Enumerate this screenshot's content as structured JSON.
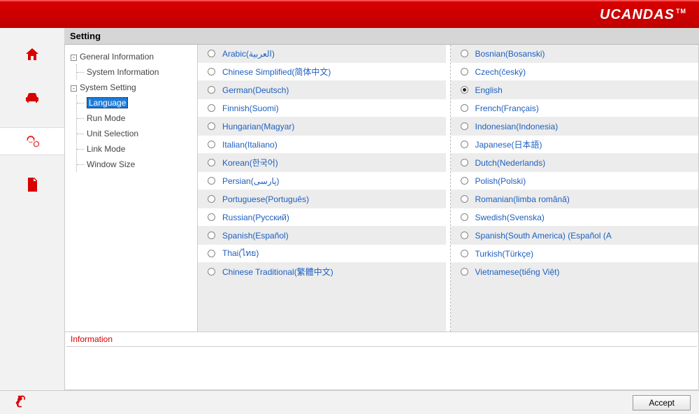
{
  "brand": {
    "name": "UCANDAS",
    "tm": "TM"
  },
  "title": "Setting",
  "tree": {
    "group1": {
      "label": "General Information",
      "children": [
        {
          "label": "System Information"
        }
      ]
    },
    "group2": {
      "label": "System Setting",
      "children": [
        {
          "label": "Language",
          "selected": true
        },
        {
          "label": "Run Mode"
        },
        {
          "label": "Unit Selection"
        },
        {
          "label": "Link Mode"
        },
        {
          "label": "Window Size"
        }
      ]
    }
  },
  "languages": {
    "left": [
      "Arabic(العربية)",
      "Chinese Simplified(简体中文)",
      "German(Deutsch)",
      "Finnish(Suomi)",
      "Hungarian(Magyar)",
      "Italian(Italiano)",
      "Korean(한국어)",
      "Persian(پارسى)",
      "Portuguese(Português)",
      "Russian(Русский)",
      "Spanish(Español)",
      "Thai(ไทย)",
      "Chinese Traditional(繁體中文)"
    ],
    "right": [
      "Bosnian(Bosanski)",
      "Czech(český)",
      "English",
      "French(Français)",
      "Indonesian(Indonesia)",
      "Japanese(日本語)",
      "Dutch(Nederlands)",
      "Polish(Polski)",
      "Romanian(limba română)",
      "Swedish(Svenska)",
      "Spanish(South America) (Español (A",
      "Turkish(Türkçe)",
      "Vietnamese(tiếng Việt)"
    ],
    "selected": "English"
  },
  "info": {
    "header": "Information"
  },
  "footer": {
    "accept": "Accept"
  }
}
